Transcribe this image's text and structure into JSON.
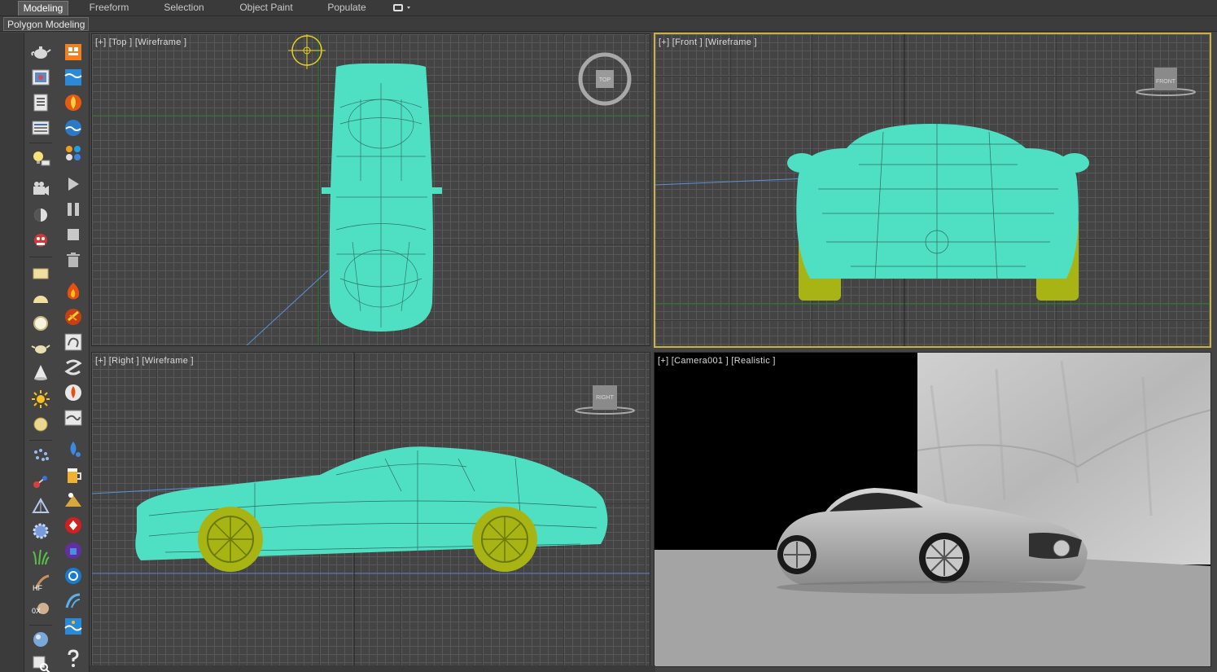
{
  "ribbon": {
    "tabs": [
      {
        "label": "Modeling",
        "active": true
      },
      {
        "label": "Freeform",
        "active": false
      },
      {
        "label": "Selection",
        "active": false
      },
      {
        "label": "Object Paint",
        "active": false
      },
      {
        "label": "Populate",
        "active": false
      }
    ],
    "subpanel_label": "Polygon Modeling"
  },
  "toolbar": {
    "column1_icons": [
      "teapot-icon",
      "render-frame-icon",
      "render-setup-icon",
      "material-editor-icon",
      "light-lister-icon",
      "camera-icon",
      "sphere-light-icon",
      "asset-tracking-icon",
      "plane-icon",
      "hemisphere-icon",
      "sphere-icon",
      "teapot-primitive-icon",
      "cone-icon",
      "sun-icon",
      "torus-icon",
      "particle-icon",
      "molecule-icon",
      "pyramid-icon",
      "gear-sphere-icon",
      "grass-icon",
      "hair-fur-icon",
      "xform-icon",
      "glass-sphere-icon",
      "search-node-icon"
    ],
    "column2_icons": [
      "scatter-icon",
      "water-icon",
      "fire-icon",
      "ocean-icon",
      "particles-icon",
      "play-icon",
      "pause-icon",
      "stop-icon",
      "trash-icon",
      "flame-icon",
      "explosion-icon",
      "smoke-icon",
      "vortex-icon",
      "torch-icon",
      "fluid-icon",
      "rain-icon",
      "beer-icon",
      "sand-icon",
      "splash-icon",
      "bubble-icon",
      "wave-icon",
      "wind-icon",
      "help-icon"
    ],
    "hair_label": "HF",
    "xform_label": "0X"
  },
  "viewports": {
    "top": {
      "label": "[+] [Top ] [Wireframe ]",
      "viewcube": "TOP"
    },
    "front": {
      "label": "[+] [Front ] [Wireframe ]",
      "viewcube": "FRONT",
      "active": true
    },
    "right": {
      "label": "[+] [Right ] [Wireframe ]",
      "viewcube": "RIGHT"
    },
    "camera": {
      "label": "[+] [Camera001 ] [Realistic ]"
    }
  },
  "colors": {
    "wire": "#4fe0c4",
    "wheel": "#a8b413",
    "active_border": "#c8b04a",
    "background": "#444444"
  }
}
